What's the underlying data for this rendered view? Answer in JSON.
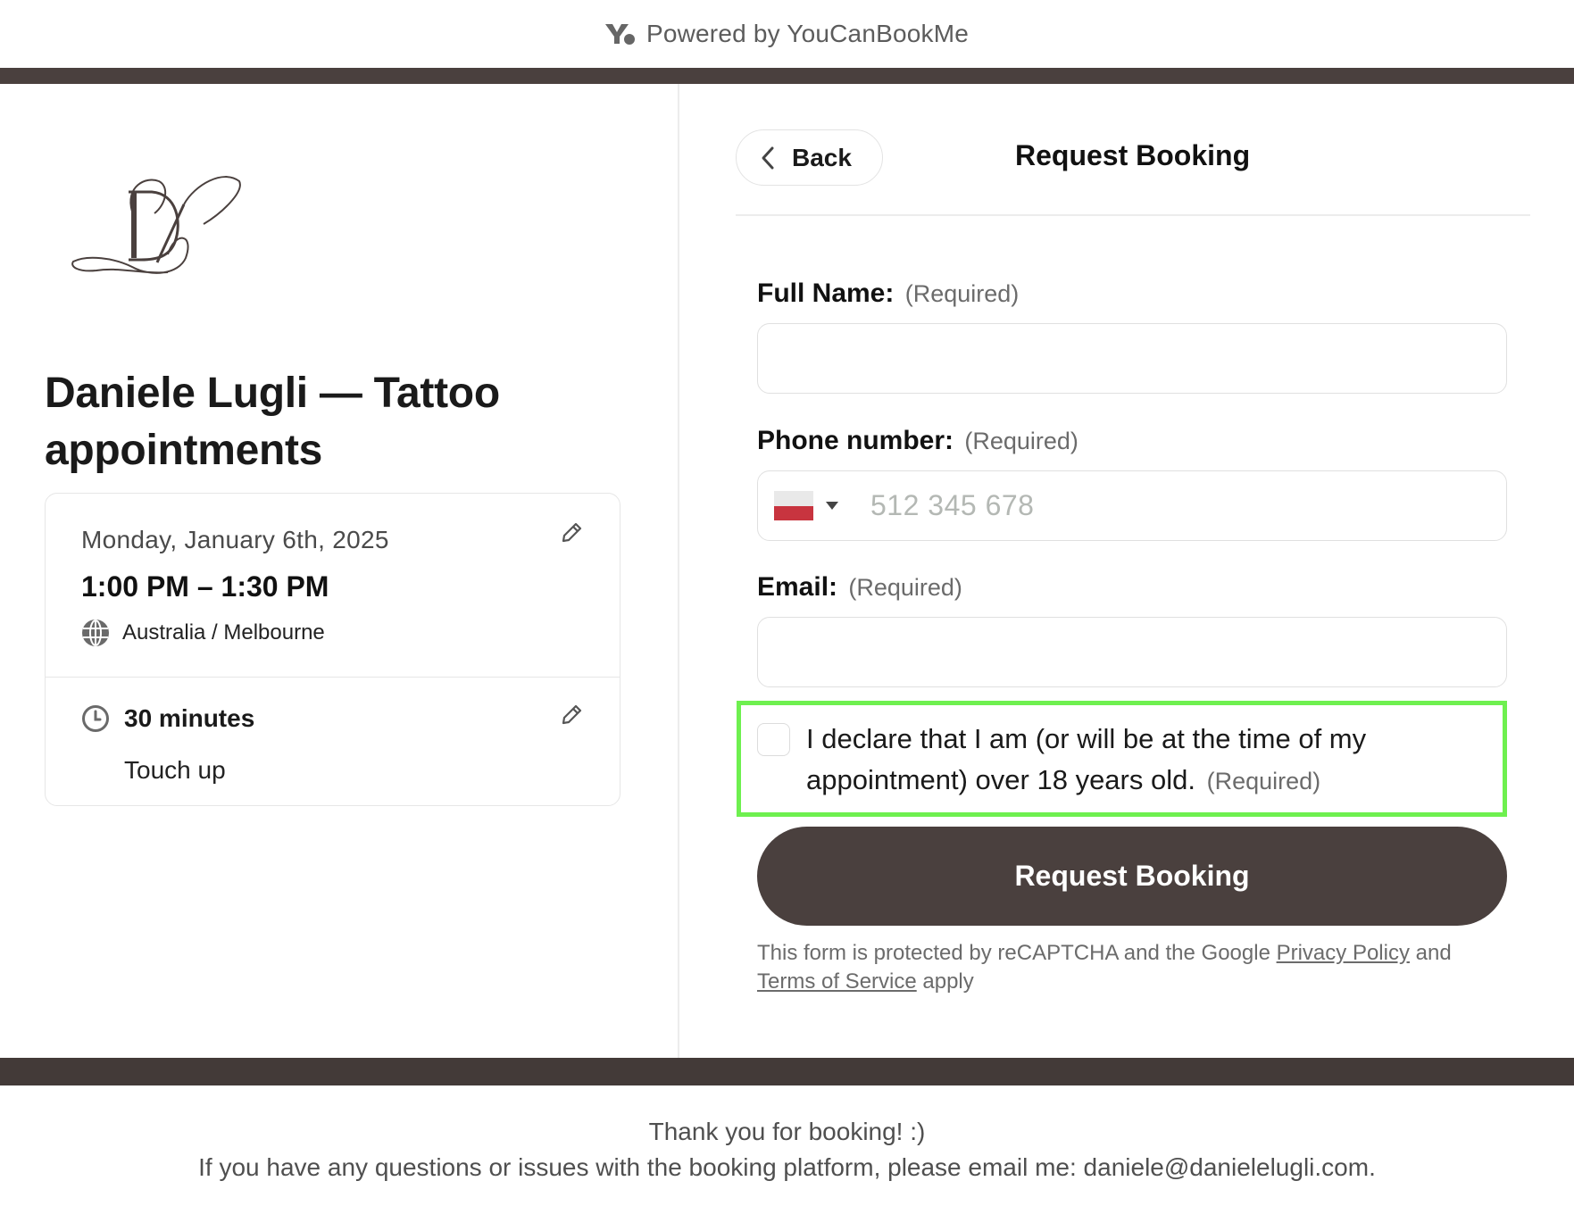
{
  "powered_by": {
    "text": "Powered by YouCanBookMe",
    "icon": "ycbm-logo-icon"
  },
  "colors": {
    "brand": "#4a403e",
    "highlight": "#6ef04f",
    "flag_red": "#c8343f"
  },
  "left": {
    "logo": "DL monogram logo",
    "title": "Daniele Lugli — Tattoo appointments",
    "booking": {
      "date": "Monday, January 6th, 2025",
      "time": "1:00 PM – 1:30 PM",
      "timezone": "Australia / Melbourne",
      "duration": "30 minutes",
      "type": "Touch up"
    }
  },
  "right": {
    "back_label": "Back",
    "title": "Request Booking",
    "fields": {
      "full_name": {
        "label": "Full Name:",
        "required": "(Required)",
        "value": ""
      },
      "phone": {
        "label": "Phone number:",
        "required": "(Required)",
        "placeholder": "512 345 678",
        "country": "Poland",
        "value": ""
      },
      "email": {
        "label": "Email:",
        "required": "(Required)",
        "value": ""
      }
    },
    "consent": {
      "text": "I declare that I am (or will be at the time of my appointment) over 18 years old.",
      "required": "(Required)",
      "checked": false
    },
    "submit_label": "Request Booking",
    "recaptcha": {
      "prefix": "This form is protected by reCAPTCHA and the Google ",
      "privacy_link": "Privacy Policy",
      "middle": " and ",
      "terms_link": "Terms of Service",
      "suffix": " apply"
    }
  },
  "footer": {
    "line1": "Thank you for booking! :)",
    "line2": "If you have any questions or issues with the booking platform, please email me: daniele@danielelugli.com."
  }
}
